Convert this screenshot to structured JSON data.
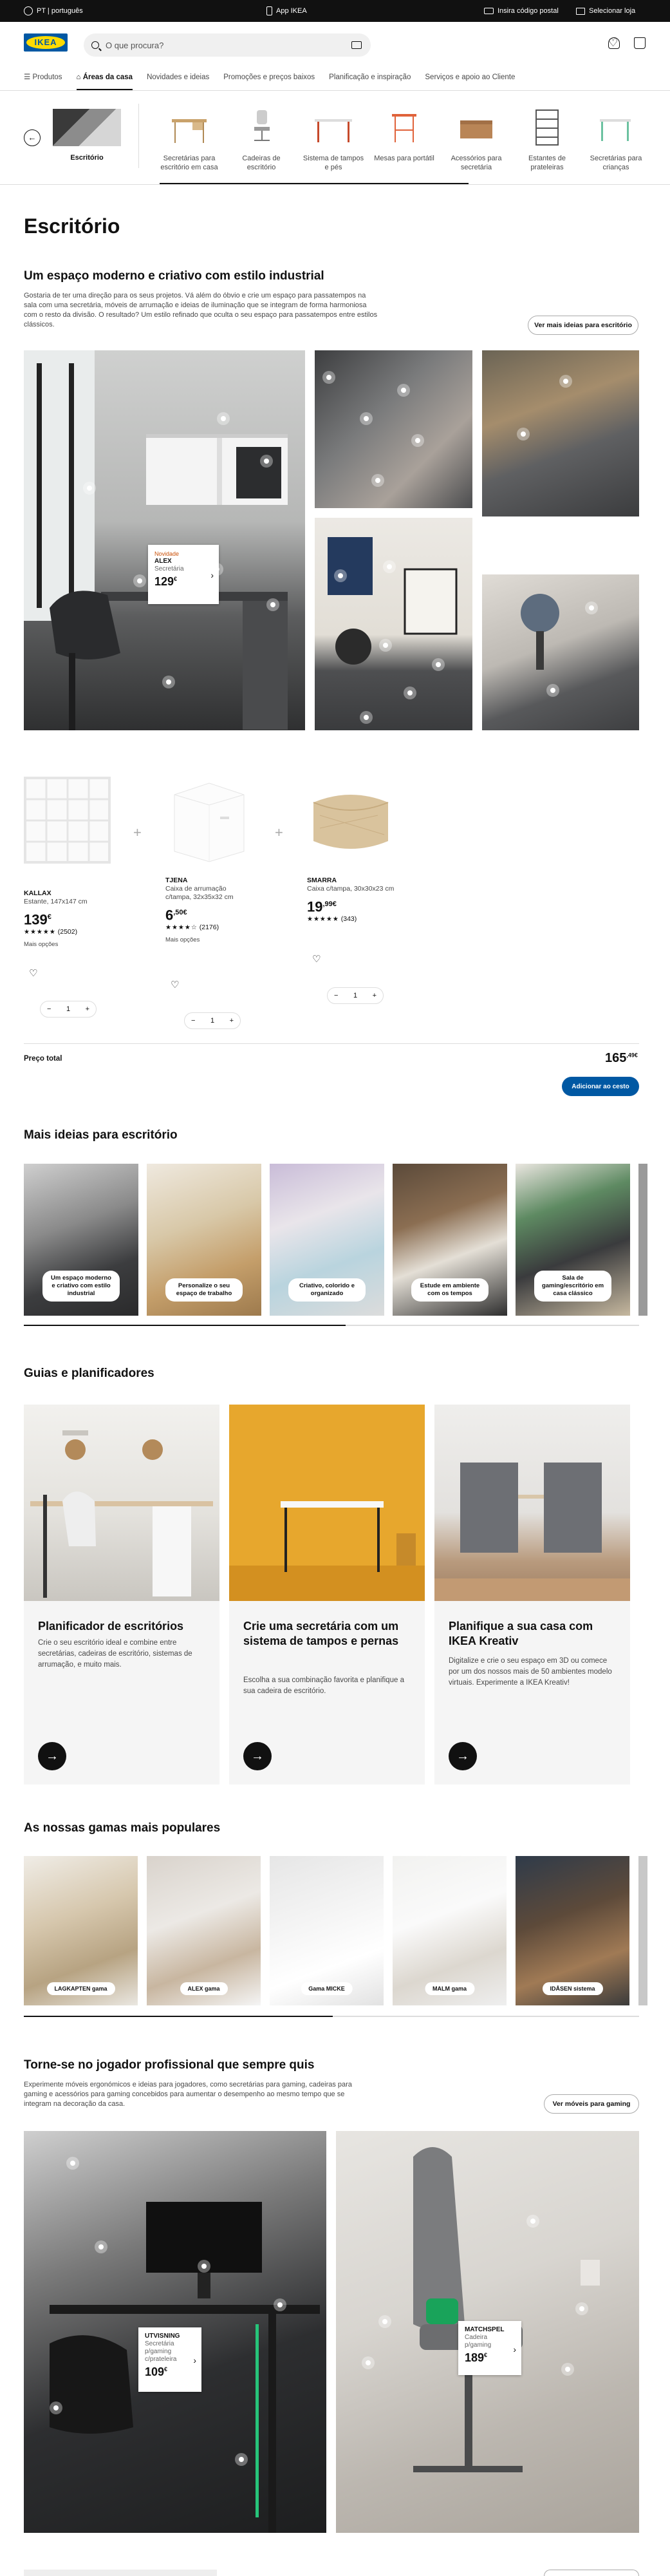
{
  "topbar": {
    "language": "PT | português",
    "app": "App IKEA",
    "postal": "Insira código postal",
    "store": "Selecionar loja"
  },
  "header": {
    "logo": "IKEA",
    "search_placeholder": "O que procura?"
  },
  "nav": [
    "Produtos",
    "Áreas da casa",
    "Novidades e ideias",
    "Promoções e preços baixos",
    "Planificação e inspiração",
    "Serviços e apoio ao Cliente"
  ],
  "categories": {
    "current": "Escritório",
    "items": [
      "Secretárias para escritório em casa",
      "Cadeiras de escritório",
      "Sistema de tampos e pés",
      "Mesas para portátil",
      "Acessórios para secretária",
      "Estantes de prateleiras",
      "Secretárias para crianças"
    ]
  },
  "page_title": "Escritório",
  "section1": {
    "title": "Um espaço moderno e criativo com estilo industrial",
    "desc": "Gostaria de ter uma direção para os seus projetos. Vá além do óbvio e crie um espaço para passatempos na sala com uma secretária, móveis de arrumação e ideias de iluminação que se integram de forma harmoniosa com o resto da divisão. O resultado? Um estilo refinado que oculta o seu espaço para passatempos entre estilos clássicos.",
    "button": "Ver mais ideias para escritório",
    "tag": {
      "badge": "Novidade",
      "name": "ALEX",
      "type": "Secretária",
      "price": "129",
      "currency": "€"
    }
  },
  "products": [
    {
      "name": "KALLAX",
      "desc": "Estante, 147x147 cm",
      "price": "139",
      "cents": "€",
      "rating": "★★★★★",
      "reviews": "(2502)",
      "more": "Mais opções",
      "qty": "1"
    },
    {
      "name": "TJENA",
      "desc": "Caixa de arrumação c/tampa, 32x35x32 cm",
      "price": "6",
      "cents": ",50€",
      "rating": "★★★★☆",
      "reviews": "(2176)",
      "more": "Mais opções",
      "qty": "1"
    },
    {
      "name": "SMARRA",
      "desc": "Caixa c/tampa, 30x30x23 cm",
      "price": "19",
      "cents": ",99€",
      "rating": "★★★★★",
      "reviews": "(343)",
      "more": "",
      "qty": "1"
    }
  ],
  "total": {
    "label": "Preço total",
    "value": "165",
    "cents": ",49€",
    "button": "Adicionar ao cesto"
  },
  "ideas": {
    "title": "Mais ideias para escritório",
    "items": [
      "Um espaço moderno e criativo com estilo industrial",
      "Personalize o seu espaço de trabalho",
      "Criativo, colorido e organizado",
      "Estude em ambiente com os tempos",
      "Sala de gaming/escritório em casa clássico"
    ]
  },
  "guides": {
    "title": "Guias e planificadores",
    "items": [
      {
        "title": "Planificador de escritórios",
        "desc": "Crie o seu escritório ideal e combine entre secretárias, cadeiras de escritório, sistemas de arrumação, e muito mais."
      },
      {
        "title": "Crie uma secretária com um sistema de tampos e pernas",
        "desc": "Escolha a sua combinação favorita e planifique a sua cadeira de escritório."
      },
      {
        "title": "Planifique a sua casa com IKEA Kreativ",
        "desc": "Digitalize e crie o seu espaço em 3D ou comece por um dos nossos mais de 50 ambientes modelo virtuais. Experimente a IKEA Kreativ!"
      }
    ]
  },
  "ranges": {
    "title": "As nossas gamas mais populares",
    "items": [
      "LAGKAPTEN gama",
      "ALEX gama",
      "Gama MICKE",
      "MALM gama",
      "IDÅSEN sistema"
    ]
  },
  "gaming": {
    "title": "Torne-se no jogador profissional que sempre quis",
    "desc": "Experimente móveis ergonómicos e ideias para jogadores, como secretárias para gaming, cadeiras para gaming e acessórios para gaming concebidos para aumentar o desempenho ao mesmo tempo que se integram na decoração da casa.",
    "button": "Ver móveis para gaming",
    "tag1": {
      "name": "UTVISNING",
      "type": "Secretária p/gaming c/prateleira",
      "price": "109",
      "currency": "€"
    },
    "tag2": {
      "name": "MATCHSPEL",
      "type": "Cadeira p/gaming",
      "price": "189",
      "currency": "€"
    }
  },
  "colors": {
    "brand_blue": "#0058a3",
    "brand_yellow": "#ffdb00",
    "badge_orange": "#ca5008"
  }
}
